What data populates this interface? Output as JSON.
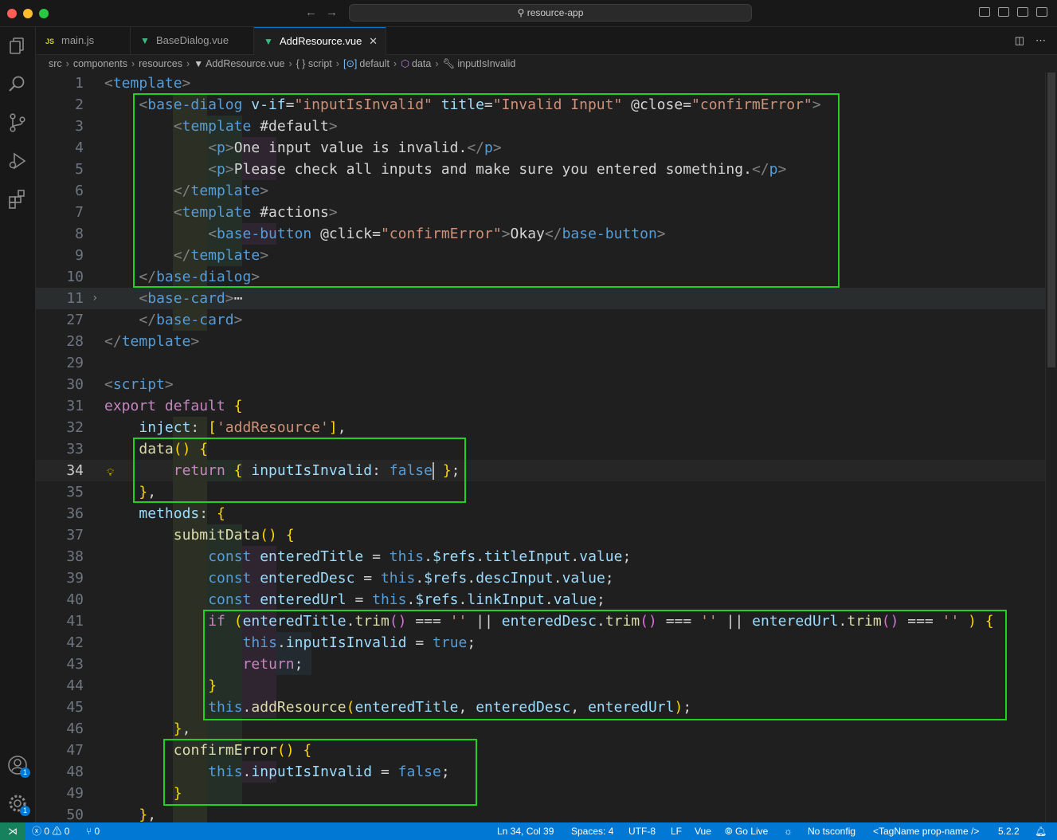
{
  "window": {
    "search_title": "resource-app"
  },
  "tabs": [
    {
      "label": "main.js",
      "icon": "javascript-file-icon",
      "active": false
    },
    {
      "label": "BaseDialog.vue",
      "icon": "vue-file-icon",
      "active": false
    },
    {
      "label": "AddResource.vue",
      "icon": "vue-file-icon",
      "active": true
    }
  ],
  "breadcrumbs": [
    "src",
    "components",
    "resources",
    "AddResource.vue",
    "{ } script",
    "default",
    "data",
    "inputIsInvalid"
  ],
  "editor": {
    "cursor": {
      "line": 34,
      "col": 39
    },
    "lines": [
      {
        "n": "1",
        "t": "<template>"
      },
      {
        "n": "2",
        "t": "  <base-dialog v-if=\"inputIsInvalid\" title=\"Invalid Input\" @close=\"confirmError\">"
      },
      {
        "n": "3",
        "t": "    <template #default>"
      },
      {
        "n": "4",
        "t": "      <p>One input value is invalid.</p>"
      },
      {
        "n": "5",
        "t": "      <p>Please check all inputs and make sure you entered something.</p>"
      },
      {
        "n": "6",
        "t": "    </template>"
      },
      {
        "n": "7",
        "t": "    <template #actions>"
      },
      {
        "n": "8",
        "t": "      <base-button @click=\"confirmError\">Okay</base-button>"
      },
      {
        "n": "9",
        "t": "    </template>"
      },
      {
        "n": "10",
        "t": "  </base-dialog>"
      },
      {
        "n": "11",
        "t": "  <base-card>⋯"
      },
      {
        "n": "27",
        "t": "  </base-card>"
      },
      {
        "n": "28",
        "t": "</template>"
      },
      {
        "n": "29",
        "t": ""
      },
      {
        "n": "30",
        "t": "<script>"
      },
      {
        "n": "31",
        "t": "export default {"
      },
      {
        "n": "32",
        "t": "  inject: ['addResource'],"
      },
      {
        "n": "33",
        "t": "  data() {"
      },
      {
        "n": "34",
        "t": "    return { inputIsInvalid: false };"
      },
      {
        "n": "35",
        "t": "  },"
      },
      {
        "n": "36",
        "t": "  methods: {"
      },
      {
        "n": "37",
        "t": "    submitData() {"
      },
      {
        "n": "38",
        "t": "      const enteredTitle = this.$refs.titleInput.value;"
      },
      {
        "n": "39",
        "t": "      const enteredDesc = this.$refs.descInput.value;"
      },
      {
        "n": "40",
        "t": "      const enteredUrl = this.$refs.linkInput.value;"
      },
      {
        "n": "41",
        "t": "      if (enteredTitle.trim() === '' || enteredDesc.trim() === '' || enteredUrl.trim() === '' ) {"
      },
      {
        "n": "42",
        "t": "        this.inputIsInvalid = true;"
      },
      {
        "n": "43",
        "t": "        return;"
      },
      {
        "n": "44",
        "t": "      }"
      },
      {
        "n": "45",
        "t": "      this.addResource(enteredTitle, enteredDesc, enteredUrl);"
      },
      {
        "n": "46",
        "t": "    },"
      },
      {
        "n": "47",
        "t": "    confirmError() {"
      },
      {
        "n": "48",
        "t": "      this.inputIsInvalid = false;"
      },
      {
        "n": "49",
        "t": "    }"
      },
      {
        "n": "50",
        "t": "  },"
      }
    ]
  },
  "statusbar": {
    "errors": "0",
    "warnings": "0",
    "ports": "0",
    "position": "Ln 34, Col 39",
    "spaces": "Spaces: 4",
    "encoding": "UTF-8",
    "eol": "LF",
    "language": "Vue",
    "go_live": "Go Live",
    "tsconfig": "No tsconfig",
    "tagname": "<TagName prop-name />",
    "version": "5.2.2"
  },
  "activity_badges": {
    "accounts": "1",
    "settings": "1"
  },
  "colors": {
    "accent": "#0078d4",
    "highlight_box": "#1ed21e",
    "remote": "#16825d"
  }
}
